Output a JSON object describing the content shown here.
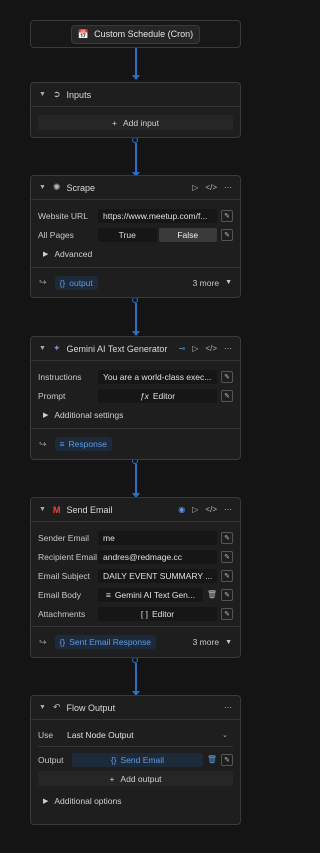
{
  "trigger": {
    "label": "Custom Schedule (Cron)"
  },
  "inputs": {
    "title": "Inputs",
    "add_label": "Add input"
  },
  "scrape": {
    "title": "Scrape",
    "url_label": "Website URL",
    "url_value": "https://www.meetup.com/f...",
    "allpages_label": "All Pages",
    "opt_true": "True",
    "opt_false": "False",
    "advanced": "Advanced",
    "output_tag": "output",
    "more": "3 more"
  },
  "gemini": {
    "title": "Gemini AI Text Generator",
    "instructions_label": "Instructions",
    "instructions_value": "You are a world-class exec...",
    "prompt_label": "Prompt",
    "prompt_value": "Editor",
    "additional": "Additional settings",
    "output_tag": "Response"
  },
  "email": {
    "title": "Send Email",
    "sender_label": "Sender Email",
    "sender_value": "me",
    "recipient_label": "Recipient Email",
    "recipient_value": "andres@redmage.cc",
    "subject_label": "Email Subject",
    "subject_value": "DAILY EVENT SUMMARY ...",
    "body_label": "Email Body",
    "body_value": "Gemini AI Text Gen...",
    "attachments_label": "Attachments",
    "attachments_value": "Editor",
    "output_tag": "Sent Email Response",
    "more": "3 more"
  },
  "flow": {
    "title": "Flow Output",
    "use_label": "Use",
    "use_value": "Last Node Output",
    "output_label": "Output",
    "output_value": "Send Email",
    "add_output": "Add output",
    "additional": "Additional options"
  }
}
